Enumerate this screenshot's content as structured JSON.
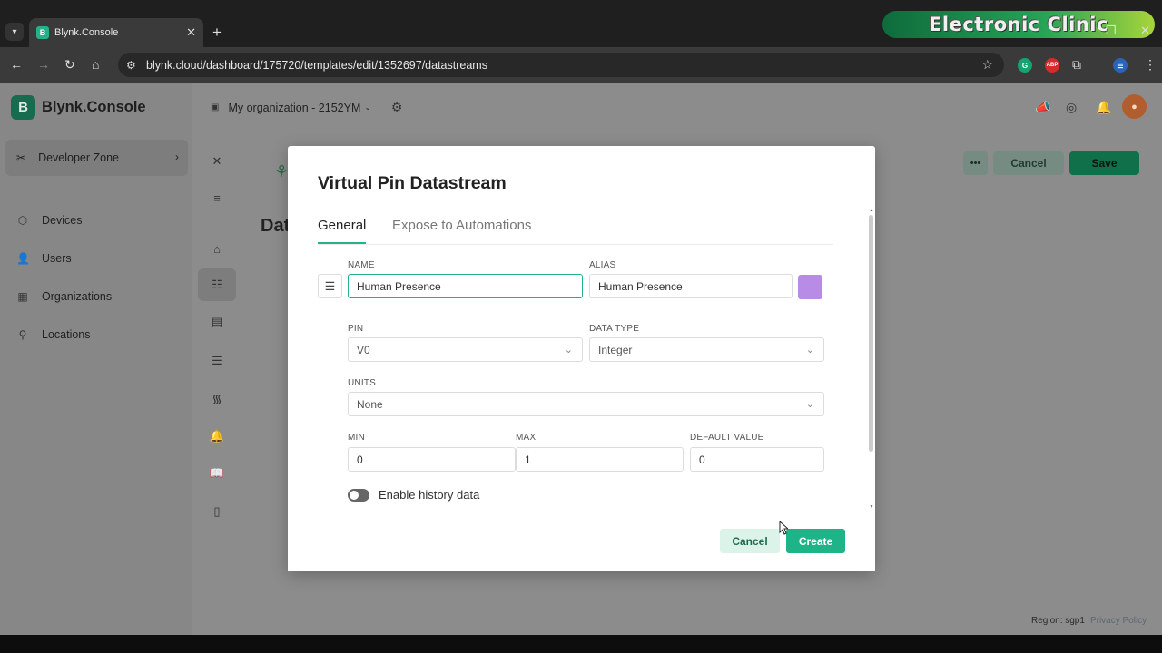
{
  "browser": {
    "tab_title": "Blynk.Console",
    "tab_favicon": "B",
    "url": "blynk.cloud/dashboard/175720/templates/edit/1352697/datastreams",
    "watermark": "Electronic Clinic",
    "extensions": [
      "G",
      "ABP"
    ]
  },
  "sidebar": {
    "brand_letter": "B",
    "brand": "Blynk.Console",
    "developer_zone": "Developer Zone",
    "items": [
      {
        "label": "Devices",
        "icon": "devices-icon"
      },
      {
        "label": "Users",
        "icon": "users-icon"
      },
      {
        "label": "Organizations",
        "icon": "organizations-icon"
      },
      {
        "label": "Locations",
        "icon": "location-pin-icon"
      }
    ]
  },
  "header": {
    "organization": "My organization - 2152YM"
  },
  "page": {
    "title_partial": "Dat",
    "cancel_label": "Cancel",
    "save_label": "Save",
    "more_label": "•••",
    "region": "Region: sgp1",
    "privacy": "Privacy Policy"
  },
  "modal": {
    "title": "Virtual Pin Datastream",
    "tabs": [
      "General",
      "Expose to Automations"
    ],
    "name_label": "NAME",
    "name_value": "Human Presence",
    "alias_label": "ALIAS",
    "alias_value": "Human Presence",
    "color": "#b88ce6",
    "pin_label": "PIN",
    "pin_value": "V0",
    "data_type_label": "DATA TYPE",
    "data_type_value": "Integer",
    "units_label": "UNITS",
    "units_value": "None",
    "min_label": "MIN",
    "min_value": "0",
    "max_label": "MAX",
    "max_value": "1",
    "default_label": "DEFAULT VALUE",
    "default_value": "0",
    "history_label": "Enable history data",
    "history_enabled": false,
    "cancel_label": "Cancel",
    "create_label": "Create"
  },
  "colors": {
    "accent": "#23b28a",
    "accent_dark": "#0f7049"
  }
}
